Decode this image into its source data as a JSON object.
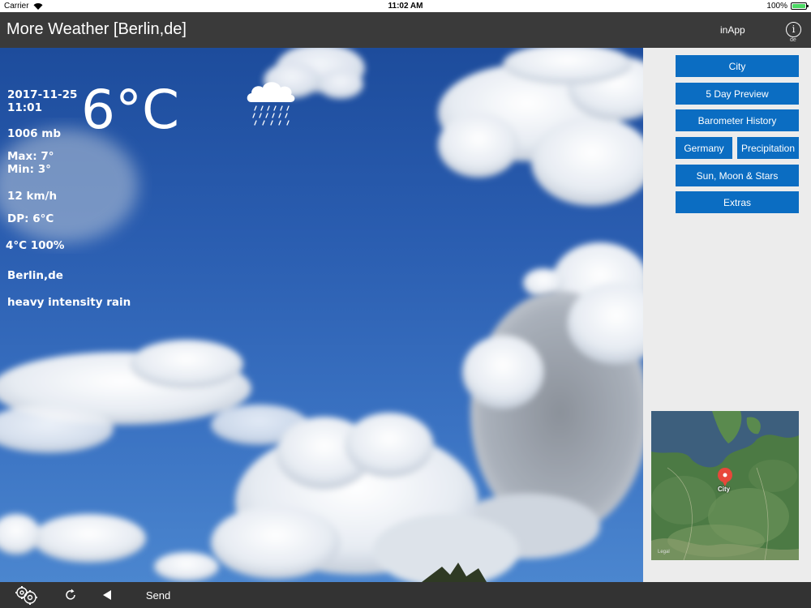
{
  "status_bar": {
    "carrier": "Carrier",
    "time": "11:02 AM",
    "battery_text": "100%",
    "battery_level": 1.0
  },
  "header": {
    "title": "More Weather [Berlin,de]",
    "inapp_label": "inApp",
    "info_label": "i",
    "info_sublabel": "de"
  },
  "weather": {
    "date": "2017-11-25",
    "time": "11:01",
    "temperature": "6°C",
    "pressure": "1006 mb",
    "max": "Max: 7°",
    "min": "Min: 3°",
    "wind": "12 km/h",
    "dew_point": "DP: 6°C",
    "temp_humidity": "4°C 100%",
    "location": "Berlin,de",
    "description": "heavy intensity rain",
    "icon": "rain-cloud-icon"
  },
  "sidebar": {
    "buttons": {
      "city": "City",
      "five_day": "5 Day Preview",
      "barometer": "Barometer History",
      "germany": "Germany",
      "precipitation": "Precipitation",
      "sun_moon": "Sun, Moon & Stars",
      "extras": "Extras"
    },
    "map": {
      "pin_label": "City",
      "legal": "Legal"
    }
  },
  "toolbar": {
    "send_label": "Send",
    "icons": [
      "gears-icon",
      "refresh-icon",
      "back-arrow-icon"
    ]
  },
  "colors": {
    "accent": "#0b6dc2",
    "header_bg": "#3a3a3a",
    "toolbar_bg": "#333333",
    "sidebar_bg": "#ececec",
    "pin": "#e8473a"
  }
}
